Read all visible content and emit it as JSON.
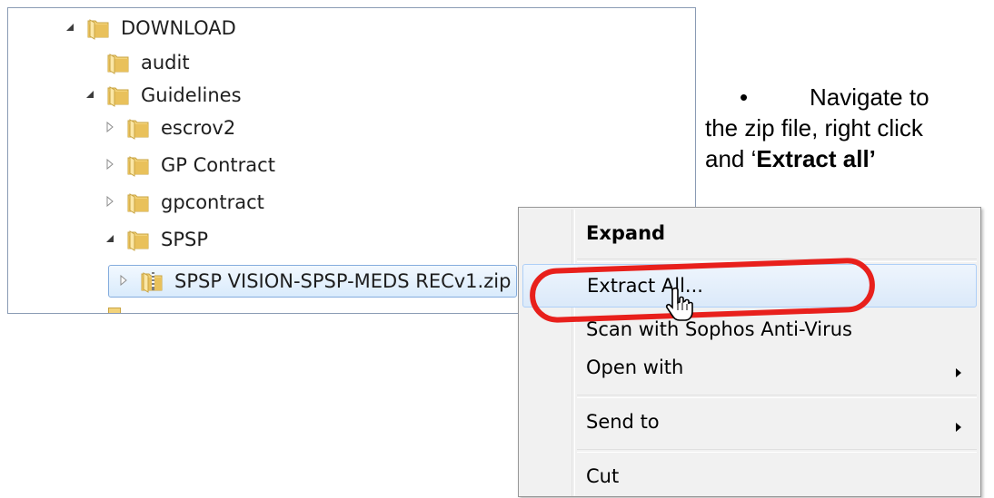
{
  "tree": {
    "items": [
      {
        "label": "DOWNLOAD",
        "level": 0,
        "expander": "expanded"
      },
      {
        "label": "audit",
        "level": 1,
        "expander": "none"
      },
      {
        "label": "Guidelines",
        "level": 1,
        "expander": "expanded"
      },
      {
        "label": "escrov2",
        "level": 2,
        "expander": "collapsed"
      },
      {
        "label": "GP Contract",
        "level": 2,
        "expander": "collapsed"
      },
      {
        "label": "gpcontract",
        "level": 2,
        "expander": "collapsed"
      },
      {
        "label": "SPSP",
        "level": 2,
        "expander": "expanded"
      },
      {
        "label": "SPSP VISION-SPSP-MEDS RECv1.zip",
        "level": 3,
        "expander": "collapsed",
        "selected": true,
        "zip": true
      }
    ]
  },
  "instruction": {
    "bullet": "•",
    "line1": "Navigate to",
    "line2": "the zip file, right click",
    "line3_prefix": "and ‘",
    "line3_bold": "Extract all’"
  },
  "context_menu": {
    "items": [
      {
        "label": "Expand",
        "bold": true
      },
      {
        "label": "Extract All...",
        "hover": true
      },
      {
        "label": "Scan with Sophos Anti-Virus"
      },
      {
        "label": "Open with",
        "submenu": true
      },
      {
        "label": "Send to",
        "submenu": true
      },
      {
        "label": "Cut"
      }
    ]
  },
  "colors": {
    "highlight_ring": "#e8201c",
    "selection_border": "#84acdd",
    "folder": "#e9c15b"
  },
  "icons": {
    "folder": "folder-icon",
    "zip": "zip-folder-icon",
    "expanded": "triangle-down-icon",
    "collapsed": "triangle-right-icon",
    "submenu": "chevron-right-icon",
    "cursor": "hand-cursor-icon"
  }
}
